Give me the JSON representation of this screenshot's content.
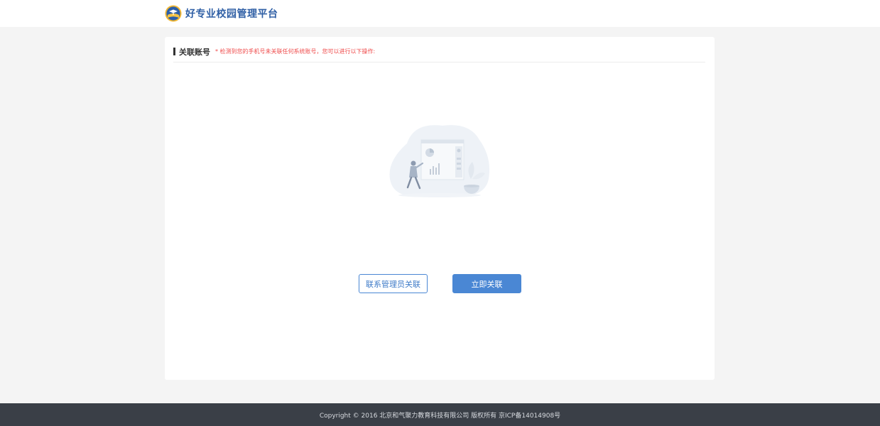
{
  "header": {
    "logo_icon": "school-emblem-icon",
    "title": "好专业校园管理平台"
  },
  "card": {
    "title": "关联账号",
    "hint": "* 检测到您的手机号未关联任何系统账号，您可以进行以下操作:",
    "illustration": "empty-state-illustration"
  },
  "actions": {
    "contact_admin_label": "联系管理员关联",
    "link_now_label": "立即关联"
  },
  "footer": {
    "copyright": "Copyright © 2016 北京和气聚力教育科技有限公司 版权所有 京ICP备14014908号"
  },
  "colors": {
    "brand_blue": "#4a87d4",
    "hint_red": "#ef4b4b",
    "footer_bg": "#3a3f47",
    "page_bg": "#f4f4f4"
  }
}
